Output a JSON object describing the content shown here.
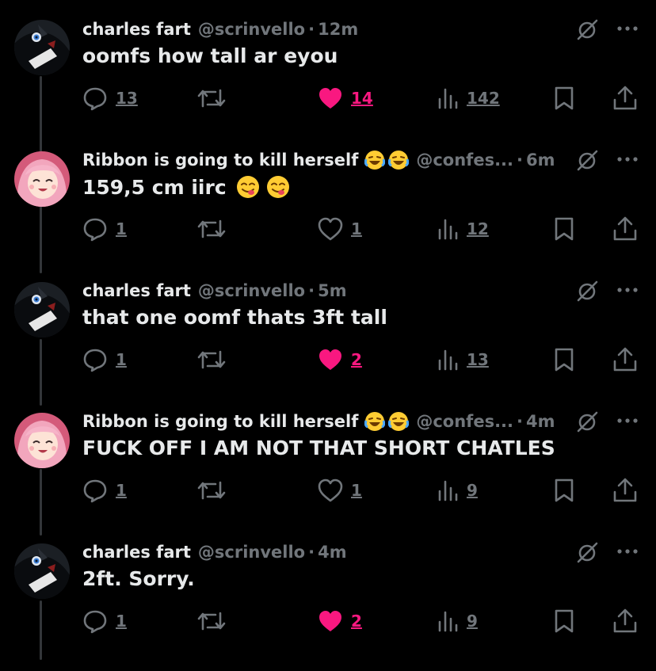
{
  "colors": {
    "background": "#000000",
    "text_primary": "#e7e9ea",
    "text_secondary": "#71767b",
    "like_active": "#f91880",
    "thread_line": "#333639"
  },
  "icons": {
    "reply": "reply-icon",
    "retweet": "retweet-icon",
    "like": "heart-icon",
    "views": "views-icon",
    "bookmark": "bookmark-icon",
    "share": "share-icon",
    "grok": "grok-icon",
    "more": "more-icon"
  },
  "tweets": [
    {
      "name": "charles fart",
      "handle": "@scrinvello",
      "time": "12m",
      "text": "oomfs how tall ar eyou",
      "replies": "13",
      "likes": "14",
      "liked": true,
      "views": "142",
      "avatar": "charles-avatar"
    },
    {
      "name": "Ribbon is going to kill herself",
      "name_emoji": "😂😂",
      "handle": "@confes...",
      "time": "6m",
      "text": "159,5 cm iirc",
      "text_emoji": "😋😋",
      "replies": "1",
      "likes": "1",
      "liked": false,
      "views": "12",
      "avatar": "ribbon-avatar"
    },
    {
      "name": "charles fart",
      "handle": "@scrinvello",
      "time": "5m",
      "text": "that one oomf thats 3ft tall",
      "replies": "1",
      "likes": "2",
      "liked": true,
      "views": "13",
      "avatar": "charles-avatar"
    },
    {
      "name": "Ribbon is going to kill herself",
      "name_emoji": "😂😂",
      "handle": "@confes...",
      "time": "4m",
      "text": "FUCK OFF I AM NOT THAT SHORT CHATLES",
      "replies": "1",
      "likes": "1",
      "liked": false,
      "views": "9",
      "avatar": "ribbon-avatar"
    },
    {
      "name": "charles fart",
      "handle": "@scrinvello",
      "time": "4m",
      "text": "2ft. Sorry.",
      "replies": "1",
      "likes": "2",
      "liked": true,
      "views": "9",
      "avatar": "charles-avatar"
    }
  ]
}
